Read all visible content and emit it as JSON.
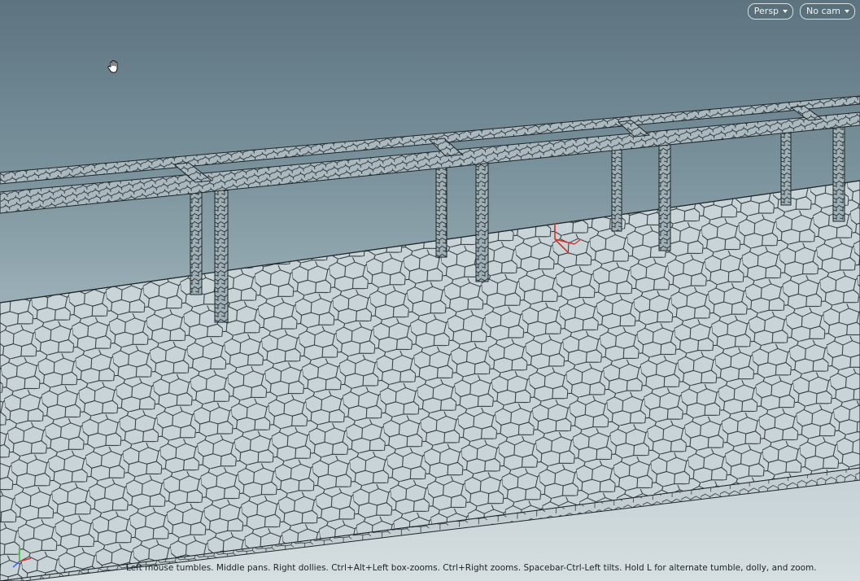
{
  "viewport": {
    "camera_mode": "Persp",
    "camera_name": "No cam",
    "status_text": "Left mouse tumbles. Middle pans. Right dollies. Ctrl+Alt+Left box-zooms. Ctrl+Right zooms. Spacebar-Ctrl-Left tilts. Hold L for alternate tumble, dolly, and zoom."
  },
  "colors": {
    "bg_top": "#5d7480",
    "bg_bottom": "#d6dfe1",
    "mesh_face": "#c9d4d8",
    "mesh_line": "#1d2528",
    "origin_axis": "#e0302a"
  },
  "icons": {
    "cursor": "hand-pan-icon",
    "axes": "axes-gizmo-icon"
  }
}
